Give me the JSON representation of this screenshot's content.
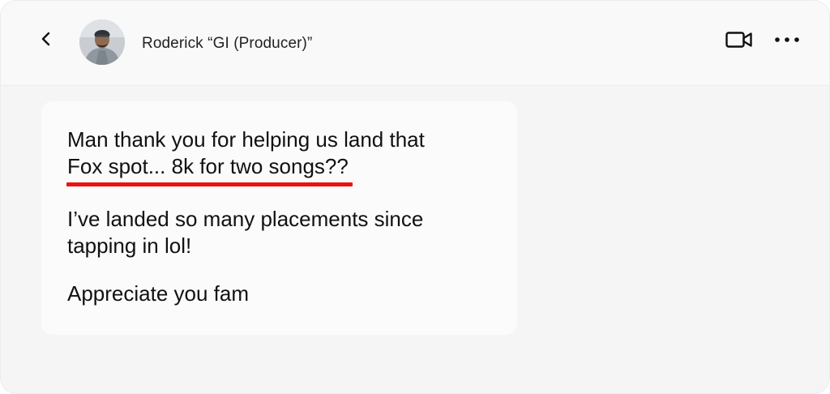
{
  "header": {
    "back_icon": "chevron-left-icon",
    "contact_name": "Roderick “GI (Producer)”",
    "video_icon": "video-camera-icon",
    "more_icon": "more-horizontal-icon"
  },
  "message": {
    "paragraph1": {
      "line1": "Man thank you for helping us land that",
      "line2": "Fox spot... 8k for two songs??"
    },
    "paragraph2": {
      "line1": "I’ve landed so many placements since",
      "line2": "tapping in lol!"
    },
    "paragraph3": {
      "line1": "Appreciate you fam"
    }
  },
  "colors": {
    "highlight_underline": "#ee1111",
    "background": "#f5f5f5",
    "bubble": "#fbfbfb",
    "text": "#111111"
  }
}
